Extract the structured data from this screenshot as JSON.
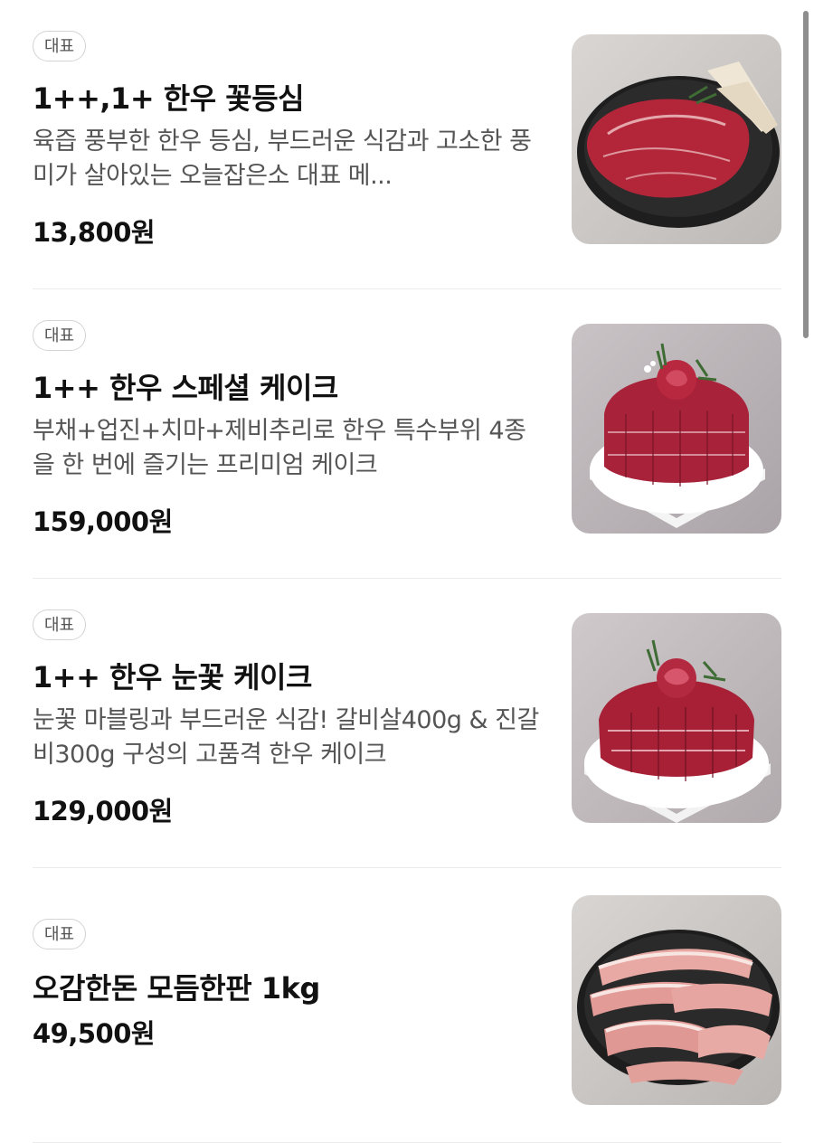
{
  "badge_label": "대표",
  "items": [
    {
      "badge": "대표",
      "title": "1++,1+ 한우 꽃등심",
      "description": "육즙 풍부한 한우 등심, 부드러운 식감과 고소한 풍미가 살아있는 오늘잡은소 대표 메...",
      "price": "13,800원",
      "image": "beef-steak-on-black-plate"
    },
    {
      "badge": "대표",
      "title": "1++ 한우 스페셜 케이크",
      "description": "부채+업진+치마+제비추리로 한우 특수부위 4종을 한 번에 즐기는 프리미엄 케이크",
      "price": "159,000원",
      "image": "beef-rose-cake"
    },
    {
      "badge": "대표",
      "title": "1++ 한우 눈꽃 케이크",
      "description": "눈꽃 마블링과 부드러운 식감! 갈비살400g & 진갈비300g 구성의 고품격 한우 케이크",
      "price": "129,000원",
      "image": "beef-snowflake-cake"
    },
    {
      "badge": "대표",
      "title": "오감한돈 모듬한판 1kg",
      "price": "49,500원",
      "image": "pork-assortment-plate"
    }
  ],
  "colors": {
    "title": "#111111",
    "description": "#555555",
    "divider": "#ececec",
    "badge_border": "#d4d4d4",
    "beef": "#b3263a",
    "pork": "#e8a9a4"
  }
}
